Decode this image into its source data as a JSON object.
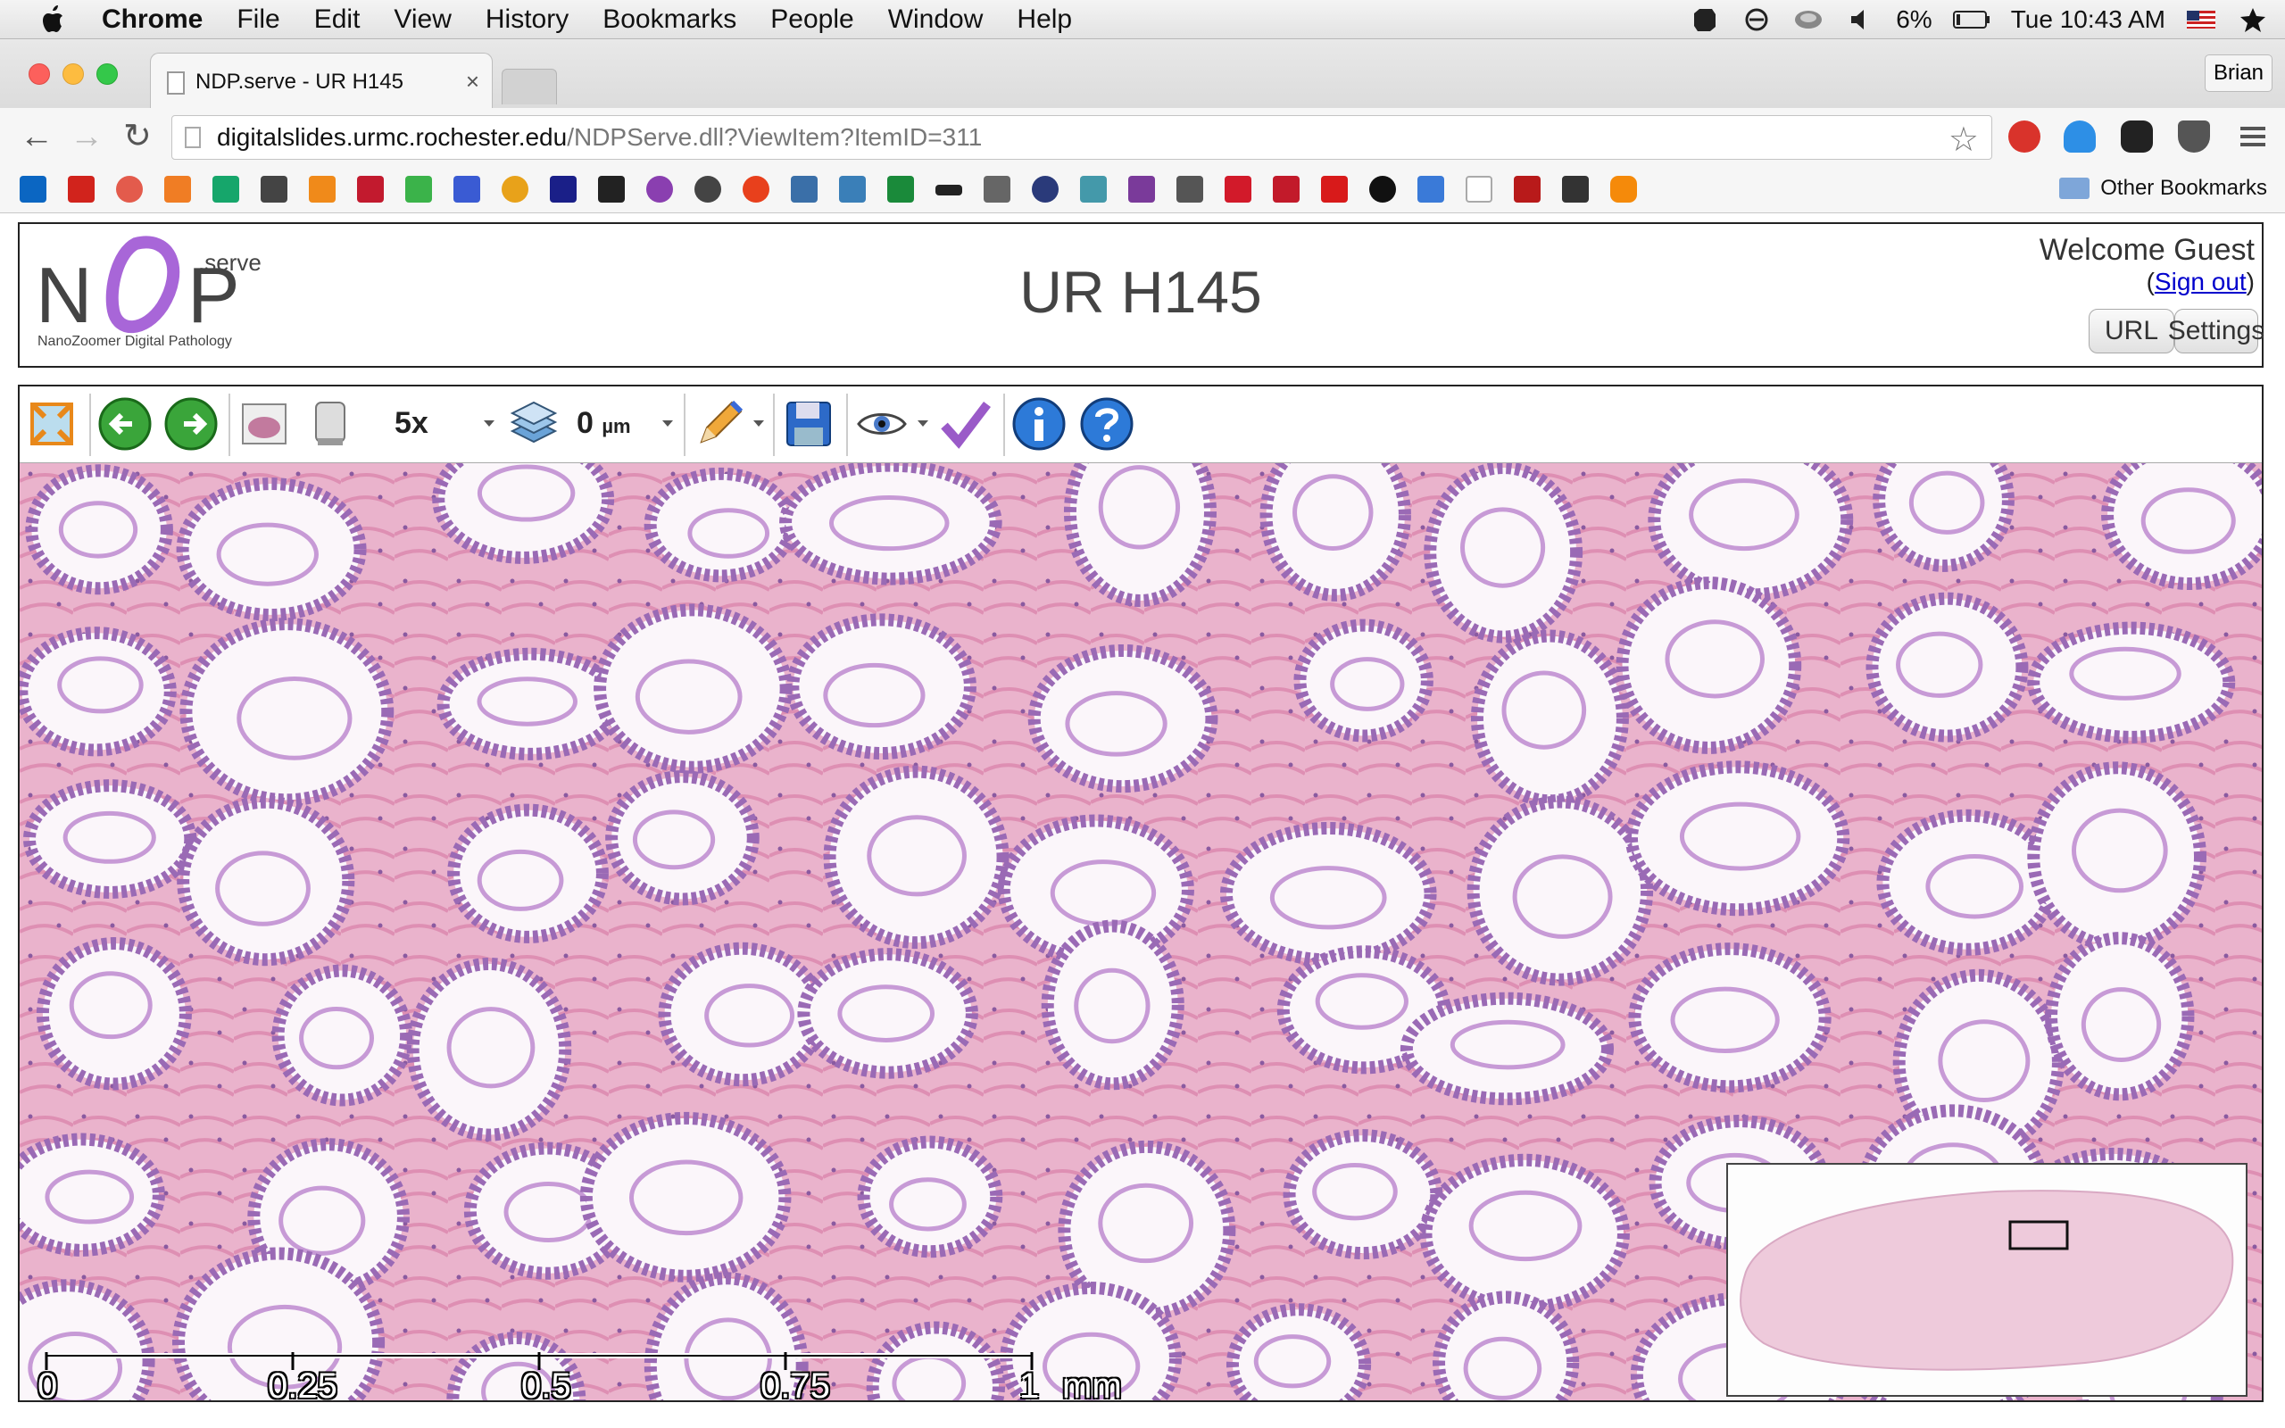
{
  "os_menubar": {
    "app": "Chrome",
    "menus": [
      "File",
      "Edit",
      "View",
      "History",
      "Bookmarks",
      "People",
      "Window",
      "Help"
    ],
    "battery": "6%",
    "clock": "Tue 10:43 AM"
  },
  "browser": {
    "tab_title": "NDP.serve - UR H145",
    "profile": "Brian",
    "url_host": "digitalslides.urmc.rochester.edu",
    "url_path": "/NDPServe.dll?ViewItem?ItemID=311",
    "other_bookmarks": "Other Bookmarks"
  },
  "header": {
    "logo_sup": ".serve",
    "logo_sub": "NanoZoomer Digital Pathology",
    "title": "UR H145",
    "welcome": "Welcome Guest",
    "sign_open": "(",
    "sign_out": "Sign out",
    "sign_close": ")",
    "url_button": "URL",
    "settings_button": "Settings"
  },
  "viewer_toolbar": {
    "zoom": "5x",
    "focus_value": "0",
    "focus_unit": "µm"
  },
  "scale_bar": {
    "labels": [
      "0",
      "0.25",
      "0.5",
      "0.75",
      "1"
    ],
    "unit": "mm"
  },
  "colors": {
    "tissue": "#e9a9c6",
    "nuclei": "#8a5aa0",
    "background": "#f7eef4"
  }
}
